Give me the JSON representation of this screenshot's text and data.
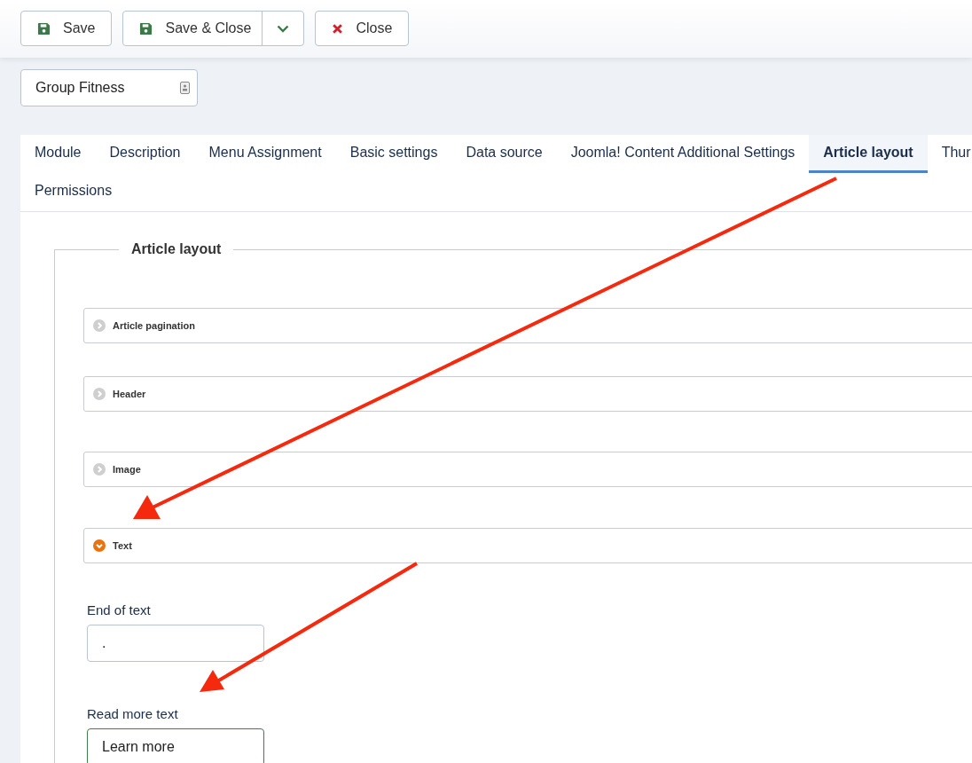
{
  "toolbar": {
    "buttons": [
      {
        "kind": "save",
        "label": "Save"
      },
      {
        "kind": "split",
        "label": "Save & Close"
      },
      {
        "kind": "close",
        "label": "Close"
      }
    ]
  },
  "title_field": {
    "value": "Group Fitness"
  },
  "tab_rows": [
    [
      {
        "label": "Module",
        "selected": false
      },
      {
        "label": "Description",
        "selected": false
      },
      {
        "label": "Menu Assignment",
        "selected": false
      },
      {
        "label": "Basic settings",
        "selected": false
      },
      {
        "label": "Data source",
        "selected": false
      },
      {
        "label": "Joomla! Content Additional Settings",
        "selected": false
      },
      {
        "label": "Article layout",
        "selected": true
      },
      {
        "label": "Thur",
        "selected": false
      }
    ],
    [
      {
        "label": "Permissions",
        "selected": false
      }
    ]
  ],
  "fieldset": {
    "legend": "Article layout",
    "sections": [
      {
        "label": "Article pagination",
        "expanded": false
      },
      {
        "label": "Header",
        "expanded": false
      },
      {
        "label": "Image",
        "expanded": false
      },
      {
        "label": "Text",
        "expanded": true
      }
    ],
    "fields": [
      {
        "label": "End of text",
        "value": ".",
        "focused": false
      },
      {
        "label": "Read more text",
        "value": "Learn more",
        "focused": true
      }
    ]
  }
}
